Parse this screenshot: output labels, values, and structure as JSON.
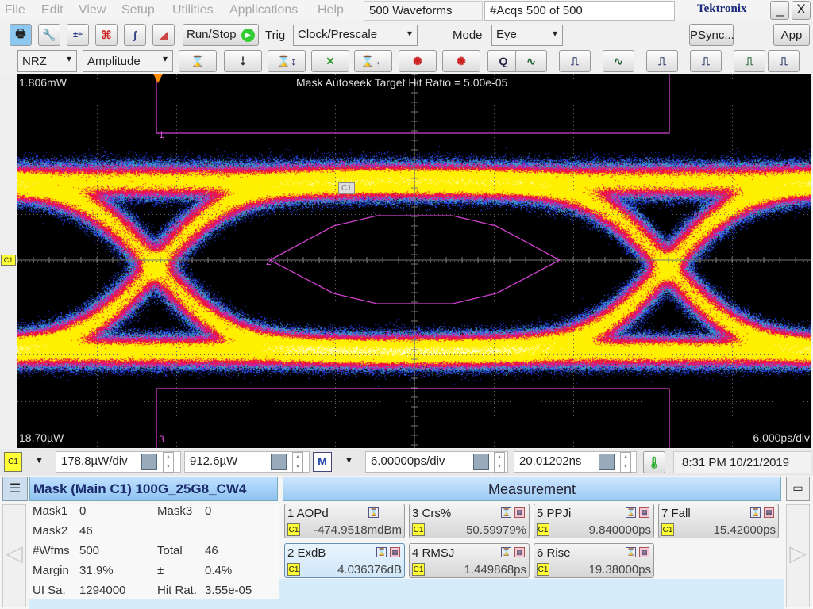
{
  "menu": {
    "items": [
      "File",
      "Edit",
      "View",
      "Setup",
      "Utilities",
      "Applications",
      "Help"
    ],
    "waveforms": "500 Waveforms",
    "acqs": "#Acqs  500 of 500",
    "brand": "Tektronix",
    "minimize": "_",
    "close": "X"
  },
  "toolbar": {
    "run_stop": "Run/Stop",
    "trig_label": "Trig",
    "trig_value": "Clock/Prescale",
    "mode_label": "Mode",
    "mode_value": "Eye",
    "psync": "PSync...",
    "app": "App"
  },
  "toolbar2": {
    "signal_type": "NRZ",
    "measure_group": "Amplitude",
    "icons": [
      "extinction-ratio-icon",
      "dbm-icon",
      "eye-height-icon",
      "crossing-icon",
      "eye-width-icon",
      "jitter-icon",
      "noise-icon",
      "q-factor-icon",
      "pulse-icon",
      "rise-icon",
      "eye-amplitude-icon",
      "fall-icon",
      "rise-time-icon",
      "fall-time-icon",
      "bit-rate-icon"
    ],
    "q": "Q"
  },
  "scope": {
    "top_level": "1.806mW",
    "bottom_level": "18.70µW",
    "timebase": "6.000ps/div",
    "title": "Mask Autoseek Target Hit Ratio = 5.00e-05",
    "mask_labels": [
      "1",
      "2",
      "3"
    ],
    "channel_marker": "C1",
    "cursor_label": "C1",
    "colors": {
      "mask": "#d040d0",
      "trigger": "#ff8c00"
    }
  },
  "status": {
    "channel": "C1",
    "vscale": "178.8µW/div",
    "offset": "912.6µW",
    "math": "M",
    "hscale": "6.00000ps/div",
    "position": "20.01202ns",
    "datetime": "8:31 PM 10/21/2019"
  },
  "mask_panel": {
    "title": "Mask (Main  C1) 100G_25G8_CW4",
    "rows": [
      {
        "l1": "Mask1",
        "v1": "0",
        "l2": "Mask3",
        "v2": "0"
      },
      {
        "l1": "Mask2",
        "v1": "46",
        "l2": "",
        "v2": ""
      },
      {
        "l1": "#Wfms",
        "v1": "500",
        "l2": "Total",
        "v2": "46"
      },
      {
        "l1": "Margin",
        "v1": "31.9%",
        "l2": "±",
        "v2": "0.4%"
      },
      {
        "l1": "UI Sa.",
        "v1": "1294000",
        "l2": "Hit Rat.",
        "v2": "3.55e-05"
      }
    ]
  },
  "measurement": {
    "title": "Measurement",
    "items": [
      {
        "name": "1 AOPd",
        "value": "-474.9518mdBm",
        "ch": "C1"
      },
      {
        "name": "3 Crs%",
        "value": "50.59979%",
        "ch": "C1"
      },
      {
        "name": "5 PPJi",
        "value": "9.840000ps",
        "ch": "C1"
      },
      {
        "name": "7 Fall",
        "value": "15.42000ps",
        "ch": "C1"
      },
      {
        "name": "2 ExdB",
        "value": "4.036376dB",
        "ch": "C1"
      },
      {
        "name": "4 RMSJ",
        "value": "1.449868ps",
        "ch": "C1"
      },
      {
        "name": "6 Rise",
        "value": "19.38000ps",
        "ch": "C1"
      }
    ]
  }
}
